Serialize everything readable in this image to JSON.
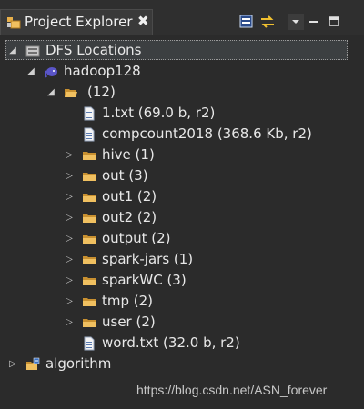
{
  "panel": {
    "title": "Project Explorer",
    "close_glyph": "✖"
  },
  "toolbar": {
    "icons": [
      "collapse-all-icon",
      "link-with-editor-icon",
      "view-menu-icon",
      "minimize-icon",
      "maximize-icon"
    ]
  },
  "tree": {
    "dfs_locations": "DFS Locations",
    "hadoop": "hadoop128",
    "root_folder": "(12)",
    "items": [
      {
        "label": "1.txt (69.0 b, r2)",
        "type": "file"
      },
      {
        "label": "compcount2018 (368.6 Kb, r2)",
        "type": "file"
      },
      {
        "label": "hive (1)",
        "type": "folder"
      },
      {
        "label": "out (3)",
        "type": "folder"
      },
      {
        "label": "out1 (2)",
        "type": "folder"
      },
      {
        "label": "out2 (2)",
        "type": "folder"
      },
      {
        "label": "output (2)",
        "type": "folder"
      },
      {
        "label": "spark-jars (1)",
        "type": "folder"
      },
      {
        "label": "sparkWC (3)",
        "type": "folder"
      },
      {
        "label": "tmp (2)",
        "type": "folder"
      },
      {
        "label": "user (2)",
        "type": "folder"
      },
      {
        "label": "word.txt (32.0 b, r2)",
        "type": "file"
      }
    ],
    "project": "algorithm"
  },
  "watermark": "https://blog.csdn.net/ASN_forever",
  "colors": {
    "background": "#2b2b2b",
    "folder": "#e8b04a",
    "hadoop": "#5a55c8"
  }
}
